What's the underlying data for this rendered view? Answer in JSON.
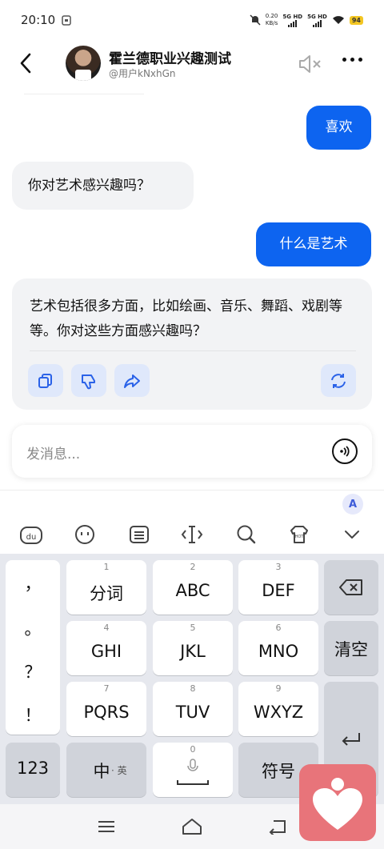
{
  "status_bar": {
    "time": "20:10",
    "net_speed": "0.20",
    "net_unit": "KB/s",
    "sim1": "5G HD",
    "sim2": "5G HD",
    "battery": "94"
  },
  "header": {
    "title": "霍兰德职业兴趣测试",
    "subtitle": "@用户kNxhGn"
  },
  "messages": [
    {
      "role": "user",
      "text": "喜欢"
    },
    {
      "role": "bot",
      "text": "你对艺术感兴趣吗？"
    },
    {
      "role": "user",
      "text": "什么是艺术"
    },
    {
      "role": "bot",
      "text": "艺术包括很多方面，比如绘画、音乐、舞蹈、戏剧等等。你对这些方面感兴趣吗？"
    }
  ],
  "message_actions": [
    "copy-icon",
    "dislike-icon",
    "share-icon",
    "regenerate-icon"
  ],
  "input": {
    "placeholder": "发消息..."
  },
  "ime": {
    "badge": "A",
    "toolbar": [
      "du-emoji-icon",
      "emoji-face-icon",
      "keyboard-layout-icon",
      "cursor-icon",
      "search-icon",
      "hot-skin-icon",
      "collapse-icon"
    ]
  },
  "keyboard": {
    "punctuation": [
      "，",
      "。",
      "？",
      "！"
    ],
    "keys": [
      {
        "num": "1",
        "label": "分词"
      },
      {
        "num": "2",
        "label": "ABC"
      },
      {
        "num": "3",
        "label": "DEF"
      },
      {
        "num": "4",
        "label": "GHI"
      },
      {
        "num": "5",
        "label": "JKL"
      },
      {
        "num": "6",
        "label": "MNO"
      },
      {
        "num": "7",
        "label": "PQRS"
      },
      {
        "num": "8",
        "label": "TUV"
      },
      {
        "num": "9",
        "label": "WXYZ"
      }
    ],
    "clear": "清空",
    "num_mode": "123",
    "lang_main": "中",
    "lang_sub": "· 英",
    "space_num": "0",
    "symbols": "符号"
  },
  "colors": {
    "accent": "#0d64f0",
    "bot_bubble": "#f2f3f5",
    "action_bg": "#dfe8fb",
    "keyboard_bg": "#e6e8ee",
    "float_widget": "#e8747a"
  }
}
